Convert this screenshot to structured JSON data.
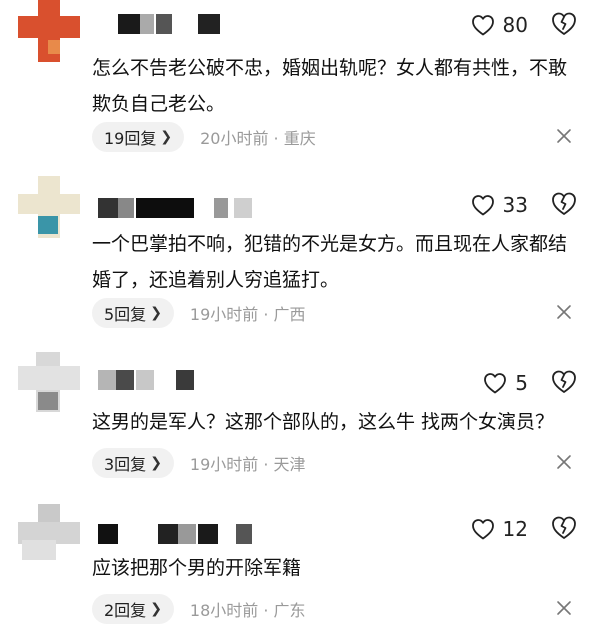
{
  "comments": [
    {
      "likes": "80",
      "text": "怎么不告老公破不忠，婚姻出轨呢？女人都有共性，不敢欺负自己老公。",
      "reply_label": "19回复",
      "time": "20小时前 · 重庆"
    },
    {
      "likes": "33",
      "text": "一个巴掌拍不响，犯错的不光是女方。而且现在人家都结婚了，还追着别人穷追猛打。",
      "reply_label": "5回复",
      "time": "19小时前 · 广西"
    },
    {
      "likes": "5",
      "text": "这男的是军人？这那个部队的，这么牛 找两个女演员？",
      "reply_label": "3回复",
      "time": "19小时前 · 天津"
    },
    {
      "likes": "12",
      "text": "应该把那个男的开除军籍",
      "reply_label": "2回复",
      "time": "18小时前 · 广东"
    }
  ],
  "icons": {
    "like": "heart-outline-icon",
    "dislike": "broken-heart-icon",
    "reply_chevron": "chevron-right-icon",
    "dismiss": "close-icon"
  },
  "colors": {
    "avatar1_red": "#d9502e",
    "avatar2_beige": "#ece5cf",
    "avatar2_teal": "#3a95a8",
    "meta_gray": "#9a9a9a"
  }
}
